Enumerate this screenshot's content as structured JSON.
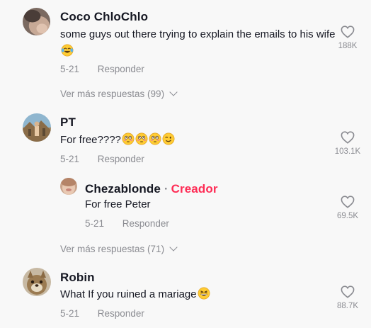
{
  "comments": [
    {
      "author": "Coco ChloChlo",
      "text": "some guys out there trying to explain the emails to his wife",
      "emojis": [
        "face-with-tears-of-joy"
      ],
      "date": "5-21",
      "reply_label": "Responder",
      "likes": "188K",
      "view_more": "Ver más respuestas (99)"
    },
    {
      "author": "PT",
      "text": "For free????",
      "emojis": [
        "flushed-face",
        "flushed-face",
        "flushed-face",
        "winking-face"
      ],
      "date": "5-21",
      "reply_label": "Responder",
      "likes": "103.1K",
      "replies": [
        {
          "author": "Chezablonde",
          "creator_label": "Creador",
          "separator": "·",
          "text": "For free Peter",
          "date": "5-21",
          "reply_label": "Responder",
          "likes": "69.5K"
        }
      ],
      "view_more": "Ver más respuestas (71)"
    },
    {
      "author": "Robin",
      "text": "What If you ruined a mariage",
      "emojis": [
        "grinning-squinting-face"
      ],
      "date": "5-21",
      "reply_label": "Responder",
      "likes": "88.7K"
    }
  ],
  "colors": {
    "background": "#f8f8f8",
    "text": "#161823",
    "muted": "#8a8b91",
    "creator": "#fe2c55"
  },
  "icons": {
    "like": "heart-outline-icon",
    "expand": "chevron-down-icon"
  }
}
